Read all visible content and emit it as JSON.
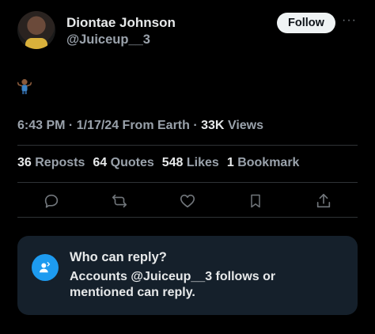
{
  "author": {
    "name": "Diontae Johnson",
    "handle": "@Juiceup__3"
  },
  "follow_label": "Follow",
  "more_label": "···",
  "tweet": {
    "emoji_icon": "person-shrugging-emoji",
    "time": "6:43 PM",
    "date": "1/17/24",
    "source": "From Earth",
    "views_count": "33K",
    "views_label": "Views"
  },
  "stats": {
    "reposts_count": "36",
    "reposts_label": "Reposts",
    "quotes_count": "64",
    "quotes_label": "Quotes",
    "likes_count": "548",
    "likes_label": "Likes",
    "bookmarks_count": "1",
    "bookmarks_label": "Bookmark"
  },
  "actions": [
    "reply-icon",
    "repost-icon",
    "like-icon",
    "bookmark-icon",
    "share-icon"
  ],
  "reply_restriction": {
    "title": "Who can reply?",
    "description": "Accounts @Juiceup__3 follows or mentioned can reply.",
    "accent_color": "#1d9bf0"
  },
  "colors": {
    "background": "#000000",
    "text": "#e7e9ea",
    "muted": "#71767b",
    "follow_bg": "#eff3f4"
  }
}
